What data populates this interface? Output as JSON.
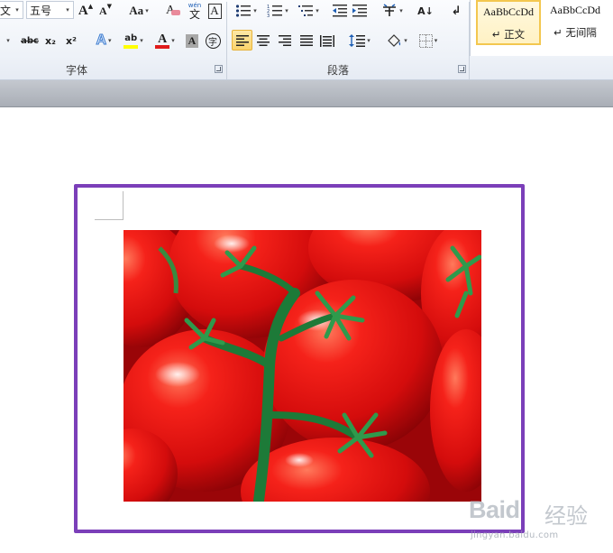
{
  "ribbon": {
    "font_group": {
      "label": "字体",
      "font_name_value": "文",
      "font_size_value": "五号",
      "grow_label": "A",
      "shrink_label": "A",
      "change_case_label": "Aa",
      "clear_format_label": "A",
      "phonetic_label": "wén",
      "phonetic_char": "文",
      "char_border_label": "A",
      "strike_label": "abc",
      "subscript_label": "x₂",
      "superscript_label": "x²",
      "text_effect_label": "A",
      "highlight_label": "ab",
      "font_color_label": "A",
      "char_shading_label": "A",
      "enclose_label": "字"
    },
    "paragraph_group": {
      "label": "段落",
      "sort_label": "A↓"
    },
    "styles_group": {
      "items": [
        {
          "sample": "AaBbCcDd",
          "name": "↵ 正文"
        },
        {
          "sample": "AaBbCcDd",
          "name": "↵ 无间隔"
        }
      ]
    },
    "colors": {
      "highlight": "#ffff00",
      "font_color": "#e01b1b",
      "accent_border": "#7b3fb9",
      "active_style": "#f3c74f"
    }
  },
  "watermark": {
    "brand": "Baid",
    "cn": "经验",
    "url": "jingyan.baidu.com"
  }
}
